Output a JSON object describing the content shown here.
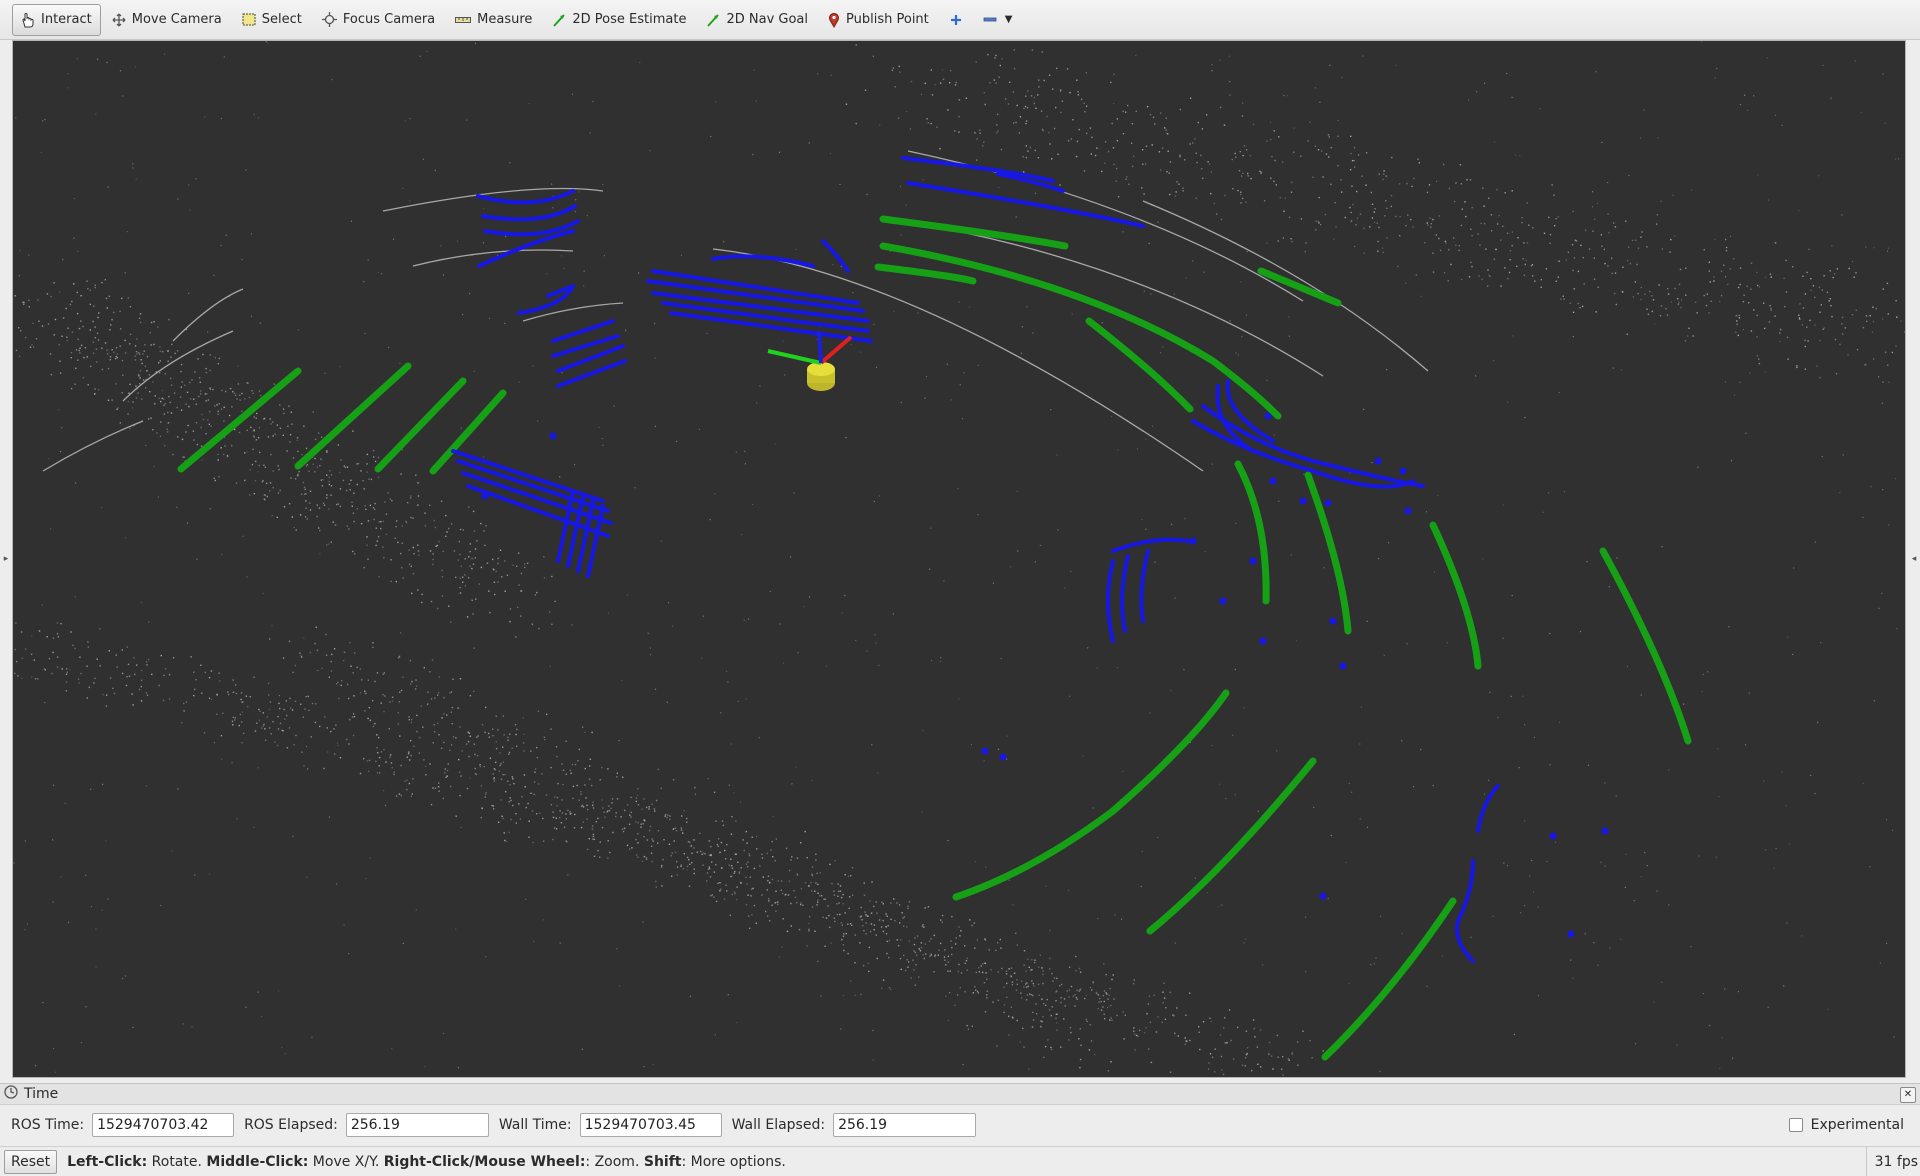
{
  "toolbar": {
    "tools": [
      {
        "label": "Interact",
        "icon": "hand-pointer-icon",
        "active": true
      },
      {
        "label": "Move Camera",
        "icon": "move-arrows-icon"
      },
      {
        "label": "Select",
        "icon": "select-box-icon"
      },
      {
        "label": "Focus Camera",
        "icon": "focus-crosshair-icon"
      },
      {
        "label": "Measure",
        "icon": "ruler-icon"
      },
      {
        "label": "2D Pose Estimate",
        "icon": "green-arrow-icon"
      },
      {
        "label": "2D Nav Goal",
        "icon": "green-arrow-icon"
      },
      {
        "label": "Publish Point",
        "icon": "map-pin-icon"
      }
    ],
    "add_tool_icon": "plus-icon",
    "remove_tool_icon": "minus-dropdown-icon"
  },
  "viewport": {
    "background_color": "#303030",
    "scan_colors": {
      "cloud": "#c8c8c8",
      "cluster": "#1f1fe0",
      "ground_lines": "#1fa51f"
    }
  },
  "time_panel": {
    "title": "Time",
    "ros_time_label": "ROS Time:",
    "ros_time_value": "1529470703.42",
    "ros_elapsed_label": "ROS Elapsed:",
    "ros_elapsed_value": "256.19",
    "wall_time_label": "Wall Time:",
    "wall_time_value": "1529470703.45",
    "wall_elapsed_label": "Wall Elapsed:",
    "wall_elapsed_value": "256.19",
    "experimental_label": "Experimental",
    "experimental_checked": false
  },
  "status_bar": {
    "reset_label": "Reset",
    "hint_left_click": "Left-Click:",
    "hint_rotate": " Rotate. ",
    "hint_middle_click": "Middle-Click:",
    "hint_move": " Move X/Y. ",
    "hint_right_click": "Right-Click/Mouse Wheel:",
    "hint_zoom": ": Zoom. ",
    "hint_shift": "Shift",
    "hint_more": ": More options.",
    "fps": "31 fps"
  }
}
